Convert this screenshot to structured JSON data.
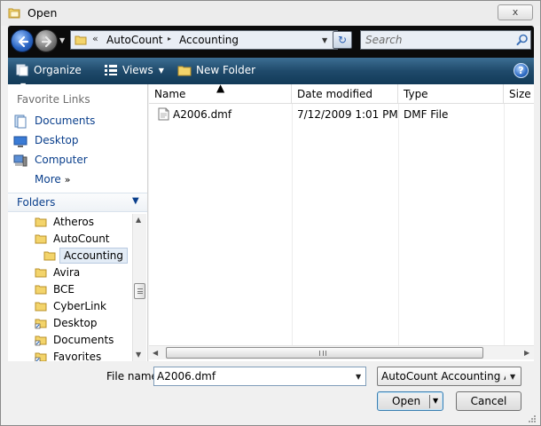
{
  "window": {
    "title": "Open",
    "close_label": "x"
  },
  "address": {
    "chevron": "«",
    "segments": [
      "AutoCount",
      "Accounting"
    ],
    "separator": "▸"
  },
  "search": {
    "placeholder": "Search"
  },
  "toolbar": {
    "organize_label": "Organize",
    "views_label": "Views",
    "new_folder_label": "New Folder",
    "help_label": "?"
  },
  "favorites": {
    "header": "Favorite Links",
    "items": [
      {
        "label": "Documents",
        "icon": "documents-icon"
      },
      {
        "label": "Desktop",
        "icon": "desktop-icon"
      },
      {
        "label": "Computer",
        "icon": "computer-icon"
      },
      {
        "label": "More",
        "icon": "more-icon"
      }
    ],
    "more_arrows": "»"
  },
  "folders": {
    "label": "Folders",
    "items": [
      {
        "label": "Atheros",
        "indent": 1
      },
      {
        "label": "AutoCount",
        "indent": 1
      },
      {
        "label": "Accounting",
        "indent": 2,
        "selected": true
      },
      {
        "label": "Avira",
        "indent": 1
      },
      {
        "label": "BCE",
        "indent": 1
      },
      {
        "label": "CyberLink",
        "indent": 1
      },
      {
        "label": "Desktop",
        "indent": 1
      },
      {
        "label": "Documents",
        "indent": 1
      },
      {
        "label": "Favorites",
        "indent": 1
      }
    ]
  },
  "filelist": {
    "columns": [
      "Name",
      "Date modified",
      "Type",
      "Size"
    ],
    "rows": [
      {
        "name": "A2006.dmf",
        "date": "7/12/2009 1:01 PM",
        "type": "DMF File",
        "size": ""
      }
    ]
  },
  "bottom": {
    "filename_label": "File name:",
    "filename_value": "A2006.dmf",
    "filter_value": "AutoCount Accounting Accou",
    "open_label": "Open",
    "cancel_label": "Cancel"
  },
  "colors": {
    "toolbar": "#1f4a6b",
    "link": "#0a3f8c",
    "address_strip": "#0b0b0b"
  }
}
